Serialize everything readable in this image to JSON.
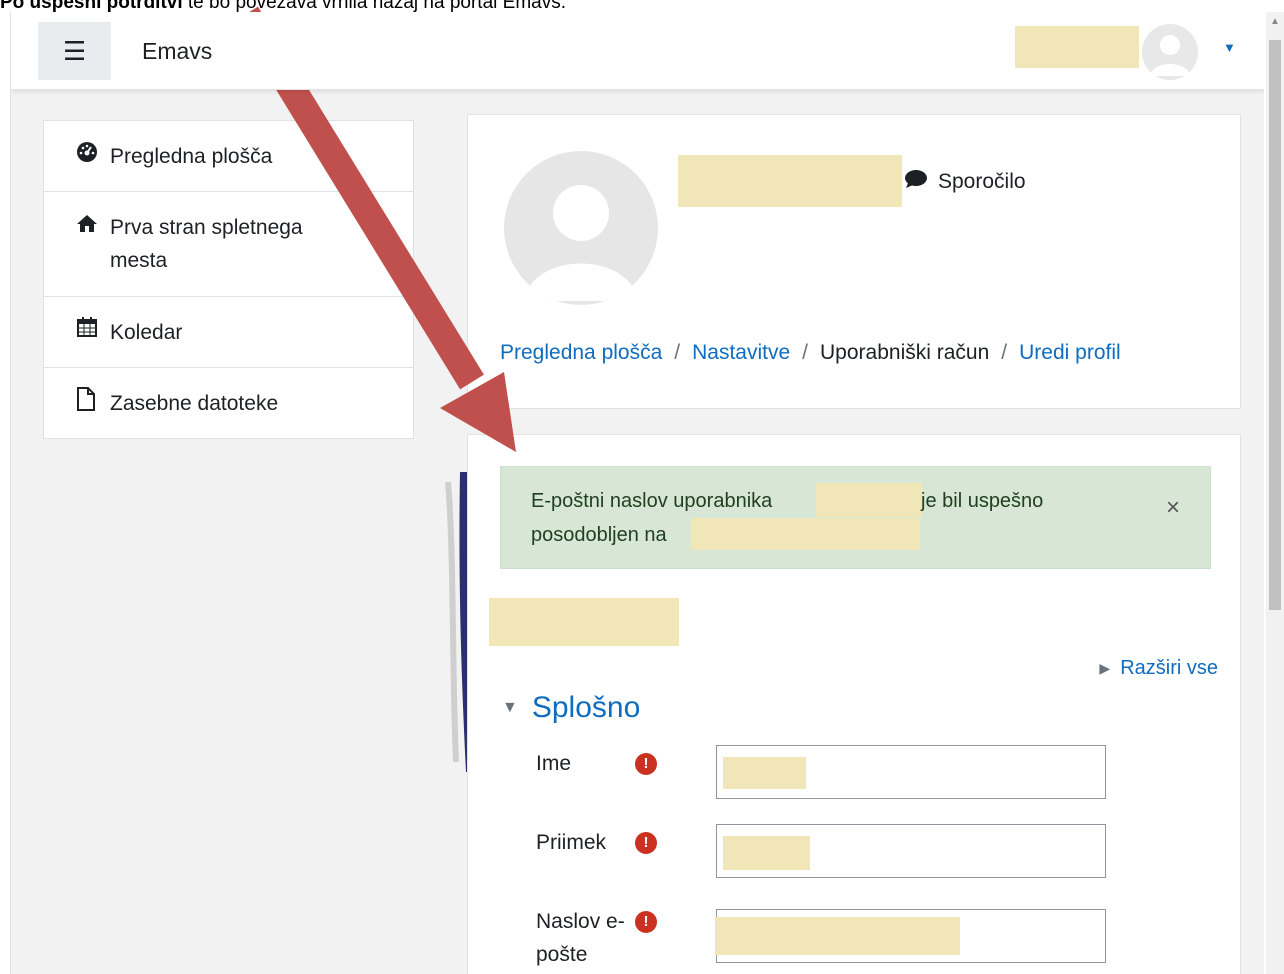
{
  "instruction": {
    "bold": "Po uspešni potrditvi",
    "rest": " te bo povezava vrnila nazaj na portal Emavs."
  },
  "navbar": {
    "menu_icon": "hamburger-icon",
    "brand": "Emavs",
    "user_icon": "user-avatar-icon",
    "caret_icon": "caret-down-icon"
  },
  "sidebar": {
    "items": [
      {
        "label": "Pregledna plošča",
        "icon": "dashboard-icon"
      },
      {
        "label": "Prva stran spletnega mesta",
        "icon": "home-icon"
      },
      {
        "label": "Koledar",
        "icon": "calendar-icon"
      },
      {
        "label": "Zasebne datoteke",
        "icon": "file-icon"
      }
    ]
  },
  "profile_header": {
    "message_label": "Sporočilo",
    "breadcrumb": [
      {
        "label": "Pregledna plošča",
        "link": true
      },
      {
        "label": "Nastavitve",
        "link": true
      },
      {
        "label": "Uporabniški račun",
        "link": false
      },
      {
        "label": "Uredi profil",
        "link": true
      }
    ]
  },
  "alert": {
    "text_part1": "E-poštni naslov uporabnika",
    "text_part2": "je bil uspešno",
    "text_part3": "posodobljen na",
    "close": "×"
  },
  "form": {
    "expand_all": "Razširi vse",
    "section_title": "Splošno",
    "fields": [
      {
        "label": "Ime",
        "required": true
      },
      {
        "label": "Priimek",
        "required": true
      },
      {
        "label_line1": "Naslov e-",
        "label_line2": "pošte",
        "required": true
      }
    ]
  },
  "colors": {
    "link": "#0f6cbf",
    "alert_bg": "#d7e6d5",
    "required": "#ca3120",
    "arrow": "#c0504d",
    "redaction": "#f1e6b8"
  }
}
